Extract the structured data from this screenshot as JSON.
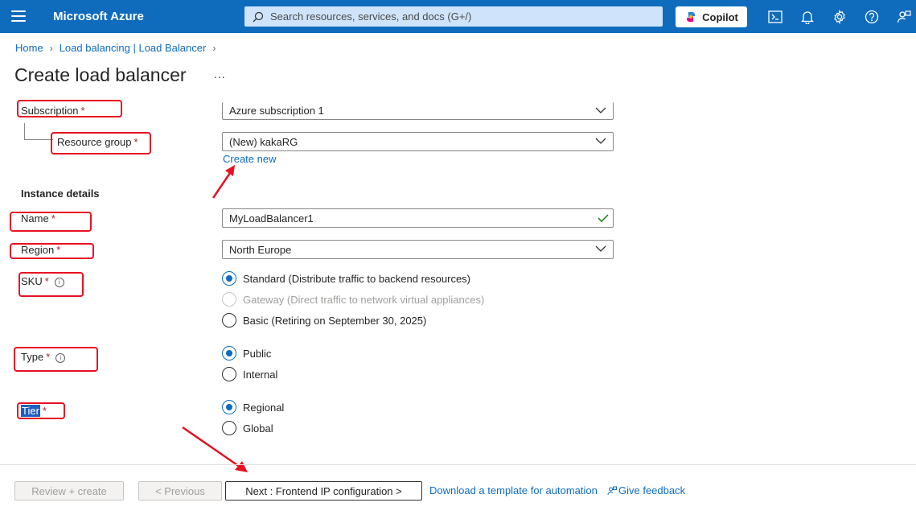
{
  "topbar": {
    "brand": "Microsoft Azure",
    "search_placeholder": "Search resources, services, and docs (G+/)",
    "copilot_label": "Copilot",
    "bg_color": "#0f6cbd"
  },
  "breadcrumb": {
    "items": [
      "Home",
      "Load balancing | Load Balancer"
    ]
  },
  "page": {
    "title": "Create load balancer",
    "more": "..."
  },
  "form": {
    "subscription": {
      "label": "Subscription",
      "required": "*",
      "value": "Azure subscription 1"
    },
    "resource_group": {
      "label": "Resource group",
      "required": "*",
      "value": "(New) kakaRG",
      "create_new": "Create new"
    },
    "instance_heading": "Instance details",
    "name": {
      "label": "Name",
      "required": "*",
      "value": "MyLoadBalancer1"
    },
    "region": {
      "label": "Region",
      "required": "*",
      "value": "North Europe"
    },
    "sku": {
      "label": "SKU",
      "required": "*",
      "options": [
        "Standard (Distribute traffic to backend resources)",
        "Gateway (Direct traffic to network virtual appliances)",
        "Basic (Retiring on September 30, 2025)"
      ],
      "selected": 0
    },
    "type": {
      "label": "Type",
      "required": "*",
      "options": [
        "Public",
        "Internal"
      ],
      "selected": 0
    },
    "tier": {
      "label": "Tier",
      "required": "*",
      "options": [
        "Regional",
        "Global"
      ],
      "selected": 0
    }
  },
  "footer": {
    "review_create": "Review + create",
    "previous": "< Previous",
    "next": "Next : Frontend IP configuration >",
    "download_template": "Download a template for automation",
    "feedback": "Give feedback"
  },
  "colors": {
    "accent": "#0f6cbd",
    "annotation": "#e81123",
    "required": "#a4262c",
    "valid": "#107c10"
  }
}
